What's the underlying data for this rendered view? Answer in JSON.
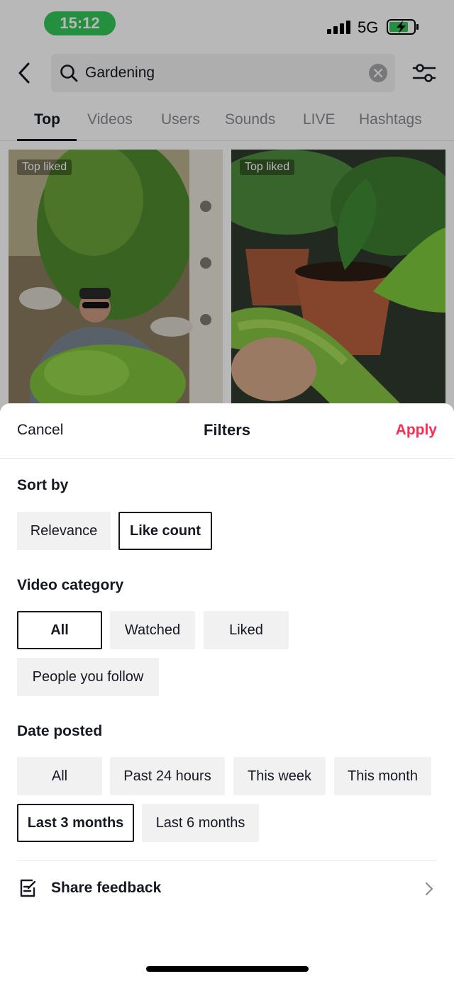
{
  "status_bar": {
    "time": "15:12",
    "network": "5G"
  },
  "search": {
    "query": "Gardening"
  },
  "tabs": [
    {
      "label": "Top"
    },
    {
      "label": "Videos"
    },
    {
      "label": "Users"
    },
    {
      "label": "Sounds"
    },
    {
      "label": "LIVE"
    },
    {
      "label": "Hashtags"
    }
  ],
  "results": [
    {
      "badge": "Top liked"
    },
    {
      "badge": "Top liked"
    }
  ],
  "sheet": {
    "cancel_label": "Cancel",
    "title": "Filters",
    "apply_label": "Apply"
  },
  "sort_by": {
    "title": "Sort by",
    "options": [
      "Relevance",
      "Like count"
    ],
    "selected": "Like count"
  },
  "video_category": {
    "title": "Video category",
    "options": [
      "All",
      "Watched",
      "Liked",
      "People you follow"
    ],
    "selected": "All"
  },
  "date_posted": {
    "title": "Date posted",
    "options": [
      "All",
      "Past 24 hours",
      "This week",
      "This month",
      "Last 3 months",
      "Last 6 months"
    ],
    "selected": "Last 3 months"
  },
  "feedback": {
    "label": "Share feedback"
  },
  "colors": {
    "accent": "#fe2c55",
    "status_pill": "#34c759",
    "chip_bg": "#f1f1f2",
    "text": "#161823"
  }
}
